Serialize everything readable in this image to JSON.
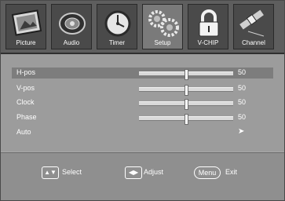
{
  "tabs": [
    {
      "label": "Picture",
      "icon": "picture-icon"
    },
    {
      "label": "Audio",
      "icon": "audio-icon"
    },
    {
      "label": "Timer",
      "icon": "clock-icon"
    },
    {
      "label": "Setup",
      "icon": "gears-icon"
    },
    {
      "label": "V-CHIP",
      "icon": "lock-icon"
    },
    {
      "label": "Channel",
      "icon": "satellite-icon"
    }
  ],
  "active_tab": "Setup",
  "menu": {
    "items": [
      {
        "label": "H-pos",
        "value": "50",
        "level": 50
      },
      {
        "label": "V-pos",
        "value": "50",
        "level": 50
      },
      {
        "label": "Clock",
        "value": "50",
        "level": 50
      },
      {
        "label": "Phase",
        "value": "50",
        "level": 50
      },
      {
        "label": "Auto",
        "arrow": "➤"
      }
    ],
    "selected": "H-pos"
  },
  "footer": {
    "select_label": "Select",
    "adjust_label": "Adjust",
    "menu_key": "Menu",
    "exit_label": "Exit"
  },
  "colors": {
    "background": "#a9a9a9",
    "tab_strip": "#5e5e5e",
    "selected_row": "#7d7d7d",
    "text": "#ffffff"
  }
}
